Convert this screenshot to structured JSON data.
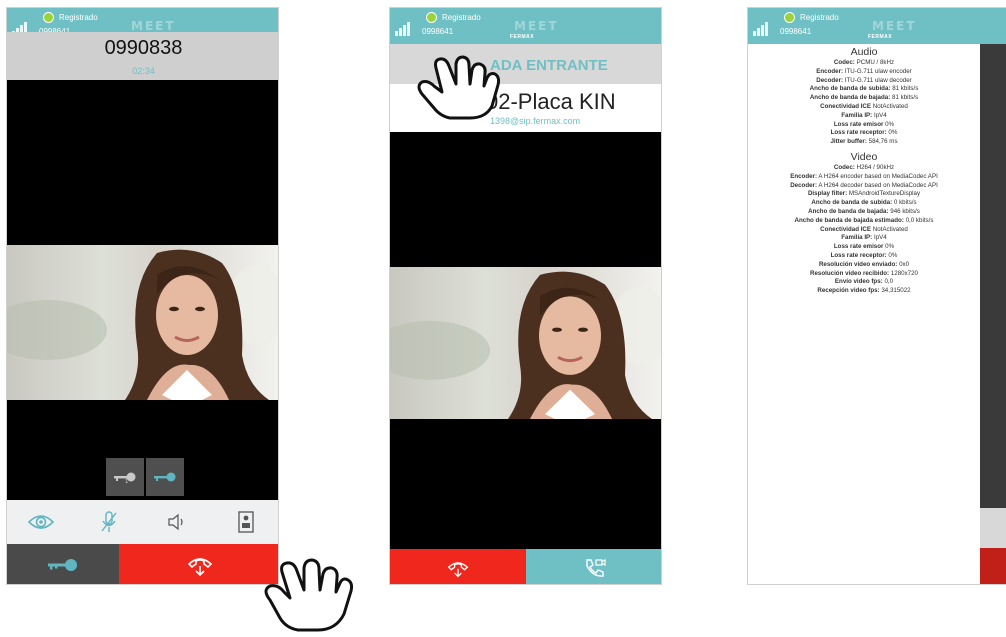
{
  "status": {
    "registered_label": "Registrado",
    "account": "0998641",
    "brand": "MEET",
    "brand_sub": "FERMAX"
  },
  "screen1": {
    "number": "0990838",
    "timer": "02:34"
  },
  "screen2": {
    "banner": "ADA ENTRANTE",
    "caller": "02-Placa KIN",
    "sip": "1398@sip.fermax.com"
  },
  "screen3": {
    "audio_title": "Audio",
    "audio_rows": [
      {
        "k": "Codec:",
        "v": "PCMU / 8kHz"
      },
      {
        "k": "Encoder:",
        "v": "ITU-G.711 ulaw encoder"
      },
      {
        "k": "Decoder:",
        "v": "ITU-G.711 ulaw decoder"
      },
      {
        "k": "Ancho de banda de subida:",
        "v": "81 kbits/s"
      },
      {
        "k": "Ancho de banda de bajada:",
        "v": "81 kbits/s"
      },
      {
        "k": "Conectividad ICE",
        "v": "NotActivated"
      },
      {
        "k": "Familia IP:",
        "v": "IpV4"
      },
      {
        "k": "Loss rate emisor",
        "v": "0%"
      },
      {
        "k": "Loss rate receptor:",
        "v": "0%"
      },
      {
        "k": "Jitter buffer:",
        "v": "584,76 ms"
      }
    ],
    "video_title": "Video",
    "video_rows": [
      {
        "k": "Codec:",
        "v": "H264 / 90kHz"
      },
      {
        "k": "Encoder:",
        "v": "A H264 encoder based on MediaCodec API"
      },
      {
        "k": "Decoder:",
        "v": "A H264 decoder based on MediaCodec API"
      },
      {
        "k": "Display filter:",
        "v": "MSAndroidTextureDisplay"
      },
      {
        "k": "Ancho de banda de subida:",
        "v": "0 kbits/s"
      },
      {
        "k": "Ancho de banda de bajada:",
        "v": "946 kbits/s"
      },
      {
        "k": "Ancho de banda de bajada estimado:",
        "v": "0,0 kbits/s"
      },
      {
        "k": "Conectividad ICE",
        "v": "NotActivated"
      },
      {
        "k": "Familia IP:",
        "v": "IpV4"
      },
      {
        "k": "Loss rate emisor",
        "v": "0%"
      },
      {
        "k": "Loss rate receptor:",
        "v": "0%"
      },
      {
        "k": "Resolución video enviado:",
        "v": "0x0"
      },
      {
        "k": "Resolución video recibido:",
        "v": "1280x720"
      },
      {
        "k": "Envío video fps:",
        "v": "0,0"
      },
      {
        "k": "Recepción video fps:",
        "v": "34,315022"
      }
    ]
  },
  "icons": [
    "signal-icon",
    "registered-dot-icon",
    "eye-icon",
    "mute-mic-icon",
    "speaker-icon",
    "intercom-icon",
    "key-icon",
    "key-1-icon",
    "hangup-icon",
    "accept-video-icon",
    "hand-pointer-icon"
  ],
  "colors": {
    "teal": "#6fc0c4",
    "red": "#f0271c",
    "dark": "#4a4a4a",
    "green_dot": "#9bd33a",
    "key_teal": "#5fb5c0"
  }
}
